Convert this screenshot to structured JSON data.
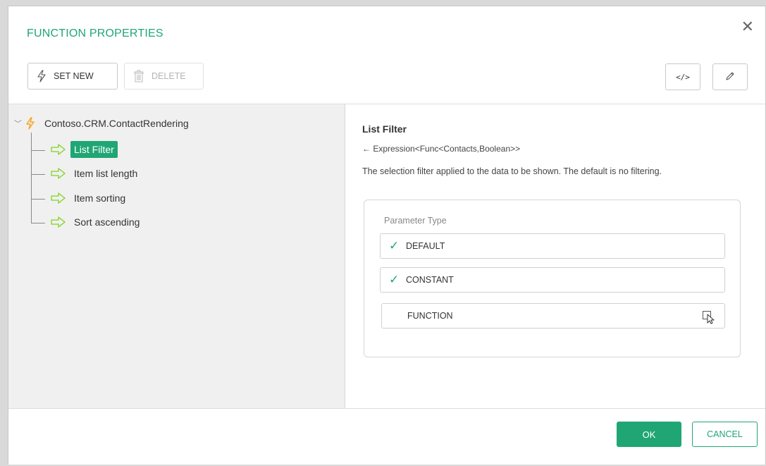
{
  "dialog": {
    "title": "FUNCTION PROPERTIES",
    "close_glyph": "✕"
  },
  "toolbar": {
    "set_new_label": "SET NEW",
    "delete_label": "DELETE",
    "code_label": "</>",
    "set_new_icon": "lightning-icon",
    "delete_icon": "trash-icon",
    "edit_icon": "pencil-icon"
  },
  "tree": {
    "root_label": "Contoso.CRM.ContactRendering",
    "items": [
      {
        "label": "List Filter",
        "selected": true
      },
      {
        "label": "Item list length",
        "selected": false
      },
      {
        "label": "Item sorting",
        "selected": false
      },
      {
        "label": "Sort ascending",
        "selected": false
      }
    ]
  },
  "details": {
    "title": "List Filter",
    "signature": "← Expression<Func<Contacts,Boolean>>",
    "description": "The selection filter applied to the data to be shown. The default is no filtering."
  },
  "parameter_type": {
    "label": "Parameter Type",
    "options": [
      {
        "label": "DEFAULT",
        "checked": true
      },
      {
        "label": "CONSTANT",
        "checked": true
      },
      {
        "label": "FUNCTION",
        "checked": false
      }
    ],
    "check_glyph": "✓"
  },
  "footer": {
    "ok_label": "OK",
    "cancel_label": "CANCEL"
  },
  "colors": {
    "accent": "#1fa674",
    "bolt": "#f5a623"
  }
}
